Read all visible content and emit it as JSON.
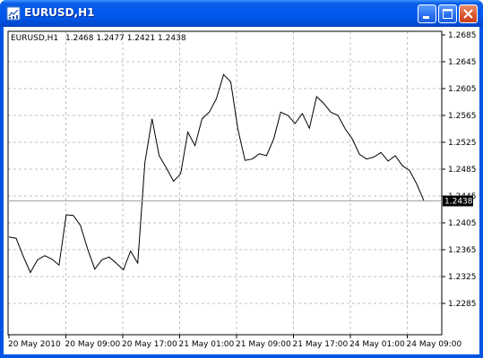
{
  "window": {
    "title": "EURUSD,H1",
    "icons": {
      "app": "chart-app-icon",
      "minimize": "minimize-icon",
      "maximize": "maximize-icon",
      "close": "close-icon"
    }
  },
  "header": {
    "symbol": "EURUSD,H1",
    "ohlc": "1.2468 1.2477 1.2421 1.2438"
  },
  "price_marker": "1.2438",
  "colors": {
    "titlebar": "#0054e3",
    "grid": "#c0c0c0",
    "line": "#000000",
    "marker_bg": "#000000",
    "marker_fg": "#ffffff"
  },
  "chart_data": {
    "type": "line",
    "title": "EURUSD,H1",
    "ylabel": "",
    "xlabel": "",
    "ylim": [
      1.2285,
      1.2685
    ],
    "y_ticks": [
      "1.2685",
      "1.2645",
      "1.2605",
      "1.2565",
      "1.2525",
      "1.2485",
      "1.2445",
      "1.2405",
      "1.2365",
      "1.2325",
      "1.2285"
    ],
    "x_ticks": [
      "20 May 2010",
      "20 May 09:00",
      "20 May 17:00",
      "21 May 01:00",
      "21 May 09:00",
      "21 May 17:00",
      "24 May 01:00",
      "24 May 09:00"
    ],
    "grid": true,
    "series": [
      {
        "values": [
          1.2384,
          1.2382,
          1.2355,
          1.2331,
          1.235,
          1.2356,
          1.2351,
          1.2342,
          1.2417,
          1.2416,
          1.2401,
          1.2366,
          1.2336,
          1.235,
          1.2354,
          1.2345,
          1.2335,
          1.2363,
          1.2345,
          1.2495,
          1.256,
          1.2505,
          1.2487,
          1.2467,
          1.2478,
          1.254,
          1.252,
          1.256,
          1.257,
          1.259,
          1.2626,
          1.2615,
          1.2545,
          1.2498,
          1.25,
          1.2508,
          1.2505,
          1.253,
          1.257,
          1.2565,
          1.2553,
          1.2568,
          1.2546,
          1.2593,
          1.2583,
          1.257,
          1.2565,
          1.2545,
          1.253,
          1.2507,
          1.25,
          1.2503,
          1.251,
          1.2497,
          1.2505,
          1.249,
          1.2483,
          1.2463,
          1.2438
        ]
      }
    ]
  }
}
